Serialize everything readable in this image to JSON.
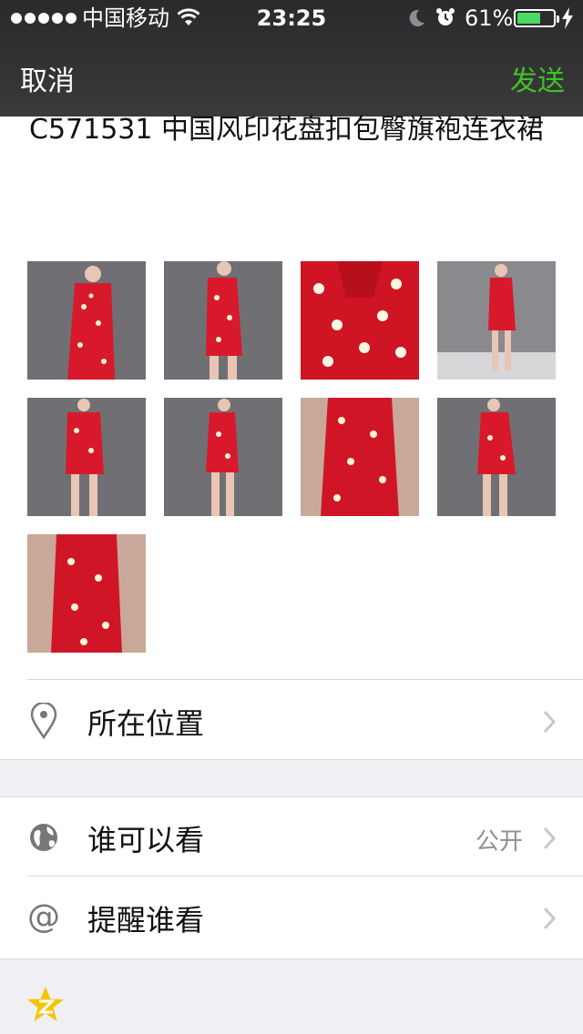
{
  "status_bar": {
    "carrier": "中国移动",
    "time": "23:25",
    "battery_percent": "61%",
    "battery_level": 0.61,
    "icons": [
      "signal-dots-icon",
      "wifi-icon",
      "moon-icon",
      "alarm-icon",
      "battery-icon",
      "charging-bolt-icon"
    ]
  },
  "nav": {
    "cancel_label": "取消",
    "send_label": "发送",
    "send_color": "#3fc226"
  },
  "post": {
    "text": "C571531  中国风印花盘扣包臀旗袍连衣裙"
  },
  "photos": {
    "count": 9,
    "subjects": [
      "red floral qipao front",
      "red floral qipao side",
      "close-up collar",
      "red floral qipao full",
      "red floral qipao front full",
      "red floral qipao side full",
      "qipao on mannequin",
      "red floral qipao back",
      "qipao close-up body"
    ]
  },
  "rows": {
    "location": {
      "label": "所在位置",
      "icon": "location-pin-icon"
    },
    "visibility": {
      "label": "谁可以看",
      "value": "公开",
      "icon": "globe-icon"
    },
    "remind": {
      "label": "提醒谁看",
      "icon": "at-sign-icon"
    }
  },
  "footer": {
    "icon": "qzone-star-icon"
  }
}
